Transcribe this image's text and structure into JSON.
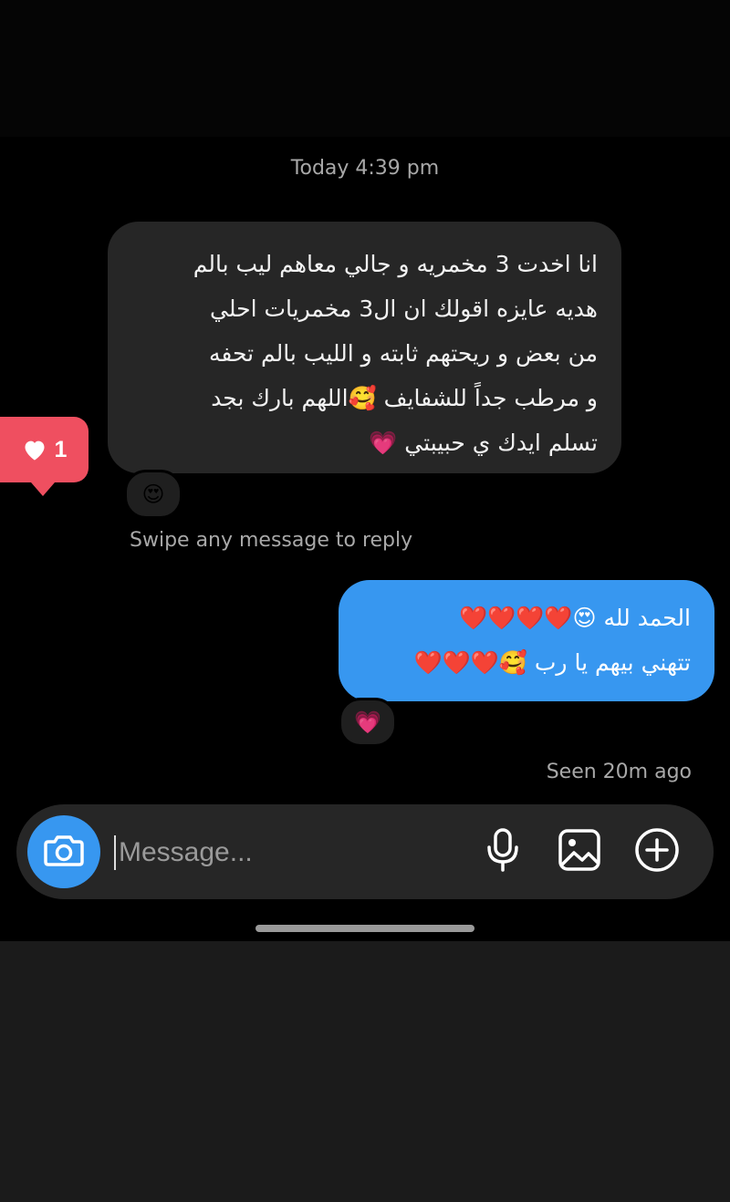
{
  "timestamp": "Today 4:39 pm",
  "incoming_message": {
    "lines": [
      "انا اخدت 3 مخمريه و جالي معاهم ليب بالم",
      "هديه عايزه اقولك ان ال3 مخمريات احلي",
      "من بعض و ريحتهم ثابته و الليب بالم تحفه",
      "و مرطب جداً للشفايف 🥰اللهم بارك بجد",
      "تسلم ايدك ي حبيبتي 💗"
    ],
    "reaction": "😍"
  },
  "like_notification": {
    "count": "1",
    "color": "#ef4f60"
  },
  "swipe_hint": "Swipe any message to reply",
  "outgoing_message": {
    "lines": [
      "الحمد لله 😍❤️❤️❤️❤️",
      "تتهني بيهم يا رب 🥰❤️❤️❤️"
    ],
    "reaction": "💗",
    "color": "#3797f0"
  },
  "seen_status": "Seen 20m ago",
  "composer": {
    "placeholder": "Message...",
    "camera_icon": "camera-icon",
    "mic_icon": "microphone-icon",
    "gallery_icon": "image-icon",
    "plus_icon": "plus-circle-icon"
  }
}
